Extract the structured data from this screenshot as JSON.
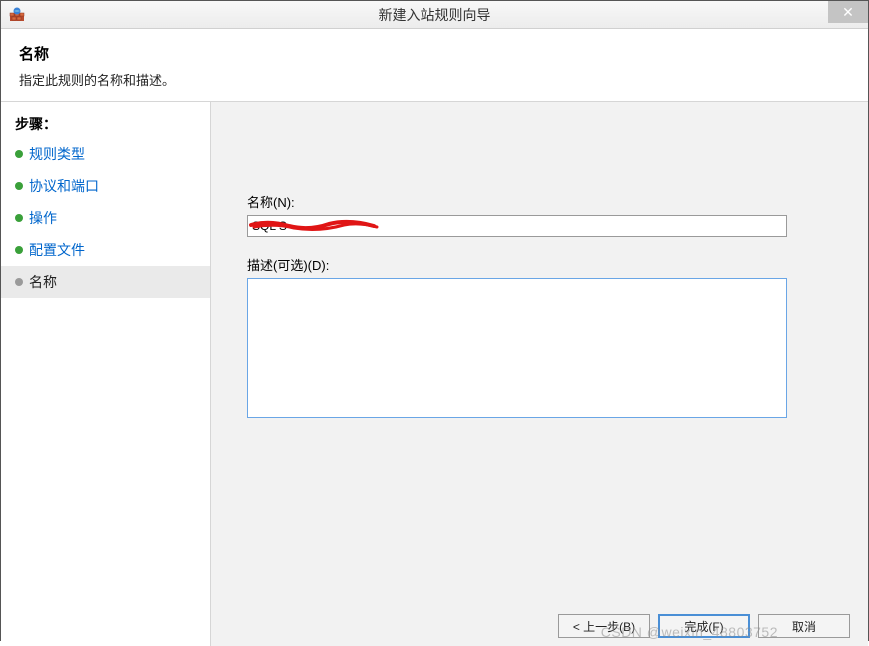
{
  "window": {
    "title": "新建入站规则向导"
  },
  "header": {
    "title": "名称",
    "subtitle": "指定此规则的名称和描述。"
  },
  "sidebar": {
    "heading": "步骤：",
    "items": [
      {
        "label": "规则类型"
      },
      {
        "label": "协议和端口"
      },
      {
        "label": "操作"
      },
      {
        "label": "配置文件"
      },
      {
        "label": "名称"
      }
    ]
  },
  "form": {
    "name_label": "名称(N):",
    "name_value": "SQL S",
    "desc_label": "描述(可选)(D):",
    "desc_value": ""
  },
  "buttons": {
    "back": "< 上一步(B)",
    "finish": "完成(F)",
    "cancel": "取消"
  },
  "watermark": "CSDN @weixin_48803752"
}
